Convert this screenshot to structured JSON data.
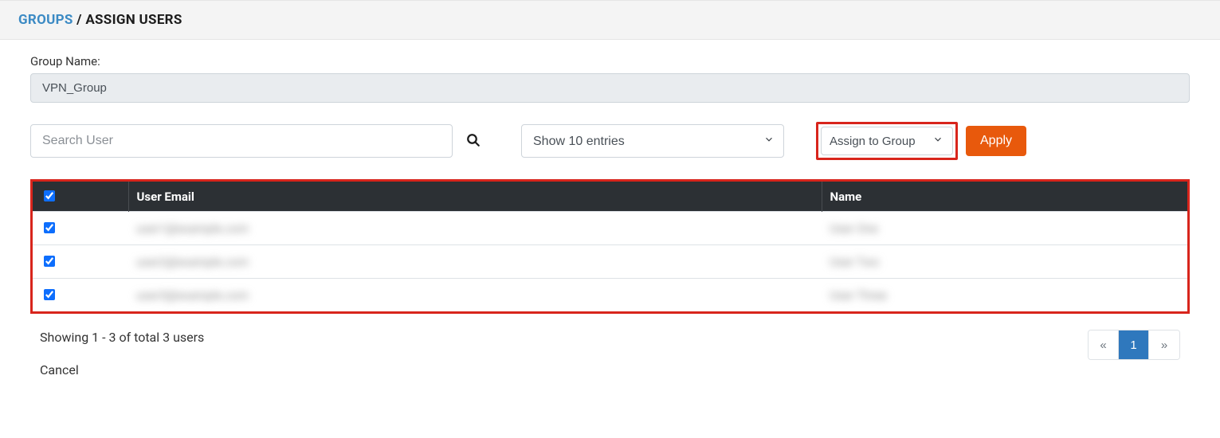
{
  "breadcrumb": {
    "groups_label": "GROUPS",
    "separator": "/",
    "current": "ASSIGN USERS"
  },
  "form": {
    "group_name_label": "Group Name:",
    "group_name_value": "VPN_Group"
  },
  "toolbar": {
    "search_placeholder": "Search User",
    "entries_option": "Show 10 entries",
    "action_option": "Assign to Group",
    "apply_label": "Apply"
  },
  "table": {
    "header_check": "",
    "header_email": "User Email",
    "header_name": "Name",
    "rows": [
      {
        "checked": true,
        "email": "user1@example.com",
        "name": "User One"
      },
      {
        "checked": true,
        "email": "user2@example.com",
        "name": "User Two"
      },
      {
        "checked": true,
        "email": "user3@example.com",
        "name": "User Three"
      }
    ]
  },
  "footer": {
    "showing_text": "Showing 1 - 3 of total 3 users",
    "cancel_label": "Cancel",
    "pager_prev": "«",
    "pager_page": "1",
    "pager_next": "»"
  }
}
